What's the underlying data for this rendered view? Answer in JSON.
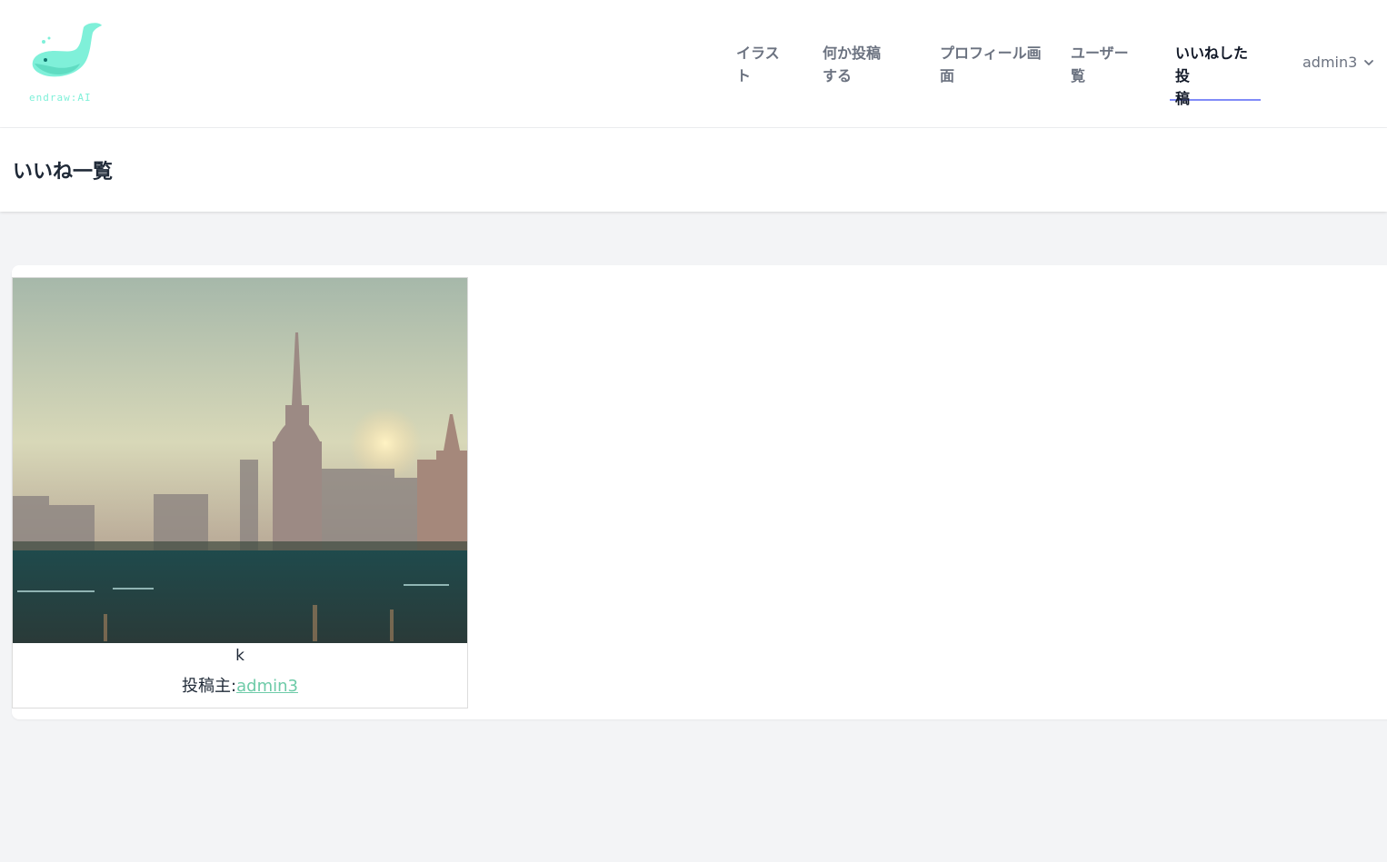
{
  "logo": {
    "text": "endraw:AI",
    "icon": "whale-icon"
  },
  "nav": {
    "items": [
      {
        "label_1": "イラス",
        "label_2": "ト",
        "active": false
      },
      {
        "label_1": "何か投稿",
        "label_2": "する",
        "active": false
      },
      {
        "label_1": "プロフィール画",
        "label_2": "面",
        "active": false
      },
      {
        "label_1": "ユーザー",
        "label_2": "覧",
        "active": false
      },
      {
        "label_1": "いいねした投",
        "label_2": "稿",
        "active": true
      }
    ],
    "user": {
      "name": "admin3",
      "icon": "chevron-down-icon"
    }
  },
  "header": {
    "title": "いいね一覧"
  },
  "posts": [
    {
      "title": "k",
      "owner_label": "投稿主:",
      "owner_name": "admin3",
      "image_icon": "city-skyline-image"
    }
  ],
  "colors": {
    "accent": "#818cf8",
    "link": "#6ecba8",
    "logo": "#7ff0d9",
    "background": "#f3f4f6"
  }
}
